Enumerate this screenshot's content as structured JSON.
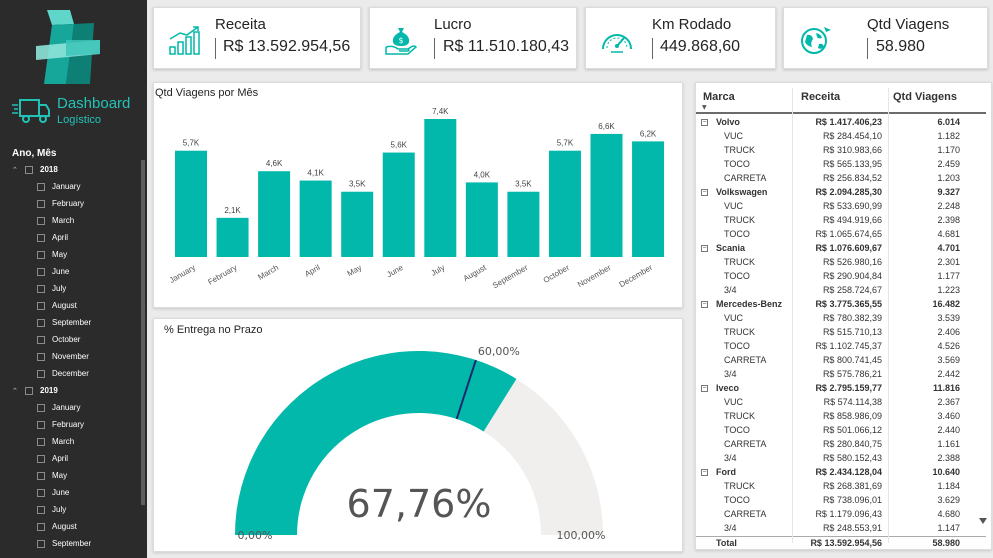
{
  "sidebar": {
    "dashboard_title": "Dashboard",
    "dashboard_subtitle": "Logístico",
    "slicer_title": "Ano, Mês",
    "years": [
      {
        "year": "2018",
        "months": [
          "January",
          "February",
          "March",
          "April",
          "May",
          "June",
          "July",
          "August",
          "September",
          "October",
          "November",
          "December"
        ]
      },
      {
        "year": "2019",
        "months": [
          "January",
          "February",
          "March",
          "April",
          "May",
          "June",
          "July",
          "August",
          "September"
        ]
      }
    ]
  },
  "kpis": {
    "receita": {
      "label": "Receita",
      "value": "R$ 13.592.954,56",
      "icon": "revenue-chart-icon"
    },
    "lucro": {
      "label": "Lucro",
      "value": "R$ 11.510.180,43",
      "icon": "money-bag-hand-icon"
    },
    "km": {
      "label": "Km Rodado",
      "value": "449.868,60",
      "icon": "speedometer-icon"
    },
    "viagens": {
      "label": "Qtd Viagens",
      "value": "58.980",
      "icon": "globe-plane-icon"
    }
  },
  "colors": {
    "accent": "#01b8aa",
    "brand_teal": "#22c3b7",
    "gauge_empty": "#f0efed",
    "target_line": "#1b2a6b"
  },
  "chart_data": [
    {
      "type": "bar",
      "title": "Qtd Viagens por Mês",
      "categories": [
        "January",
        "February",
        "March",
        "April",
        "May",
        "June",
        "July",
        "August",
        "September",
        "October",
        "November",
        "December"
      ],
      "values": [
        5700,
        2100,
        4600,
        4100,
        3500,
        5600,
        7400,
        4000,
        3500,
        5700,
        6600,
        6200
      ],
      "data_labels": [
        "5,7K",
        "2,1K",
        "4,6K",
        "4,1K",
        "3,5K",
        "5,6K",
        "7,4K",
        "4,0K",
        "3,5K",
        "5,7K",
        "6,6K",
        "6,2K"
      ],
      "ylim": [
        0,
        7400
      ]
    },
    {
      "type": "gauge",
      "title": "% Entrega no Prazo",
      "value": 0.6776,
      "value_label": "67,76%",
      "min": 0,
      "min_label": "0,00%",
      "max": 1,
      "max_label": "100,00%",
      "target": 0.6,
      "target_label": "60,00%"
    }
  ],
  "matrix": {
    "headers": [
      "Marca",
      "Receita",
      "Qtd Viagens"
    ],
    "rows": [
      {
        "kind": "brand",
        "name": "Volvo",
        "receita": "R$ 1.417.406,23",
        "qtd": "6.014"
      },
      {
        "kind": "child",
        "name": "VUC",
        "receita": "R$ 284.454,10",
        "qtd": "1.182"
      },
      {
        "kind": "child",
        "name": "TRUCK",
        "receita": "R$ 310.983,66",
        "qtd": "1.170"
      },
      {
        "kind": "child",
        "name": "TOCO",
        "receita": "R$ 565.133,95",
        "qtd": "2.459"
      },
      {
        "kind": "child",
        "name": "CARRETA",
        "receita": "R$ 256.834,52",
        "qtd": "1.203"
      },
      {
        "kind": "brand",
        "name": "Volkswagen",
        "receita": "R$ 2.094.285,30",
        "qtd": "9.327"
      },
      {
        "kind": "child",
        "name": "VUC",
        "receita": "R$ 533.690,99",
        "qtd": "2.248"
      },
      {
        "kind": "child",
        "name": "TRUCK",
        "receita": "R$ 494.919,66",
        "qtd": "2.398"
      },
      {
        "kind": "child",
        "name": "TOCO",
        "receita": "R$ 1.065.674,65",
        "qtd": "4.681"
      },
      {
        "kind": "brand",
        "name": "Scania",
        "receita": "R$ 1.076.609,67",
        "qtd": "4.701"
      },
      {
        "kind": "child",
        "name": "TRUCK",
        "receita": "R$ 526.980,16",
        "qtd": "2.301"
      },
      {
        "kind": "child",
        "name": "TOCO",
        "receita": "R$ 290.904,84",
        "qtd": "1.177"
      },
      {
        "kind": "child",
        "name": "3/4",
        "receita": "R$ 258.724,67",
        "qtd": "1.223"
      },
      {
        "kind": "brand",
        "name": "Mercedes-Benz",
        "receita": "R$ 3.775.365,55",
        "qtd": "16.482"
      },
      {
        "kind": "child",
        "name": "VUC",
        "receita": "R$ 780.382,39",
        "qtd": "3.539"
      },
      {
        "kind": "child",
        "name": "TRUCK",
        "receita": "R$ 515.710,13",
        "qtd": "2.406"
      },
      {
        "kind": "child",
        "name": "TOCO",
        "receita": "R$ 1.102.745,37",
        "qtd": "4.526"
      },
      {
        "kind": "child",
        "name": "CARRETA",
        "receita": "R$ 800.741,45",
        "qtd": "3.569"
      },
      {
        "kind": "child",
        "name": "3/4",
        "receita": "R$ 575.786,21",
        "qtd": "2.442"
      },
      {
        "kind": "brand",
        "name": "Iveco",
        "receita": "R$ 2.795.159,77",
        "qtd": "11.816"
      },
      {
        "kind": "child",
        "name": "VUC",
        "receita": "R$ 574.114,38",
        "qtd": "2.367"
      },
      {
        "kind": "child",
        "name": "TRUCK",
        "receita": "R$ 858.986,09",
        "qtd": "3.460"
      },
      {
        "kind": "child",
        "name": "TOCO",
        "receita": "R$ 501.066,12",
        "qtd": "2.440"
      },
      {
        "kind": "child",
        "name": "CARRETA",
        "receita": "R$ 280.840,75",
        "qtd": "1.161"
      },
      {
        "kind": "child",
        "name": "3/4",
        "receita": "R$ 580.152,43",
        "qtd": "2.388"
      },
      {
        "kind": "brand",
        "name": "Ford",
        "receita": "R$ 2.434.128,04",
        "qtd": "10.640"
      },
      {
        "kind": "child",
        "name": "TRUCK",
        "receita": "R$ 268.381,69",
        "qtd": "1.184"
      },
      {
        "kind": "child",
        "name": "TOCO",
        "receita": "R$ 738.096,01",
        "qtd": "3.629"
      },
      {
        "kind": "child",
        "name": "CARRETA",
        "receita": "R$ 1.179.096,43",
        "qtd": "4.680"
      },
      {
        "kind": "child",
        "name": "3/4",
        "receita": "R$ 248.553,91",
        "qtd": "1.147"
      }
    ],
    "total": {
      "name": "Total",
      "receita": "R$ 13.592.954,56",
      "qtd": "58.980"
    }
  }
}
